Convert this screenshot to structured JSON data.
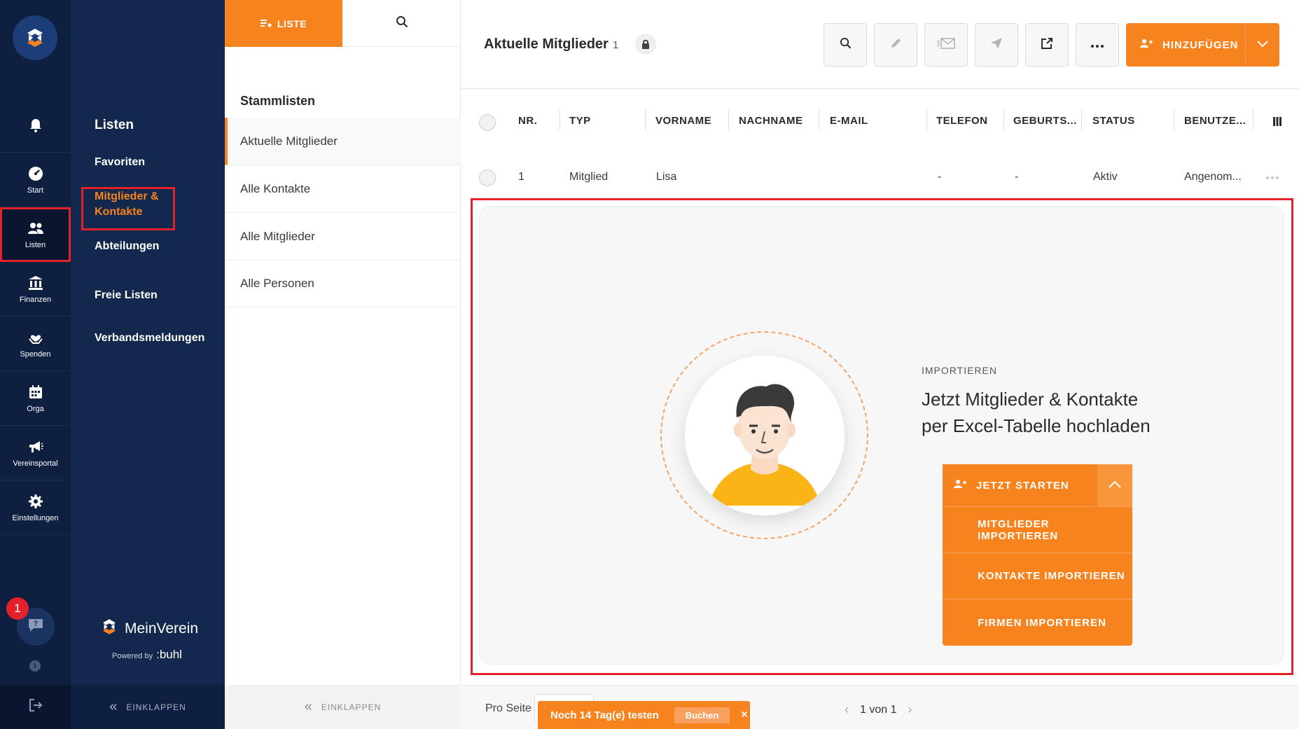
{
  "rail": {
    "items": [
      {
        "label": "",
        "icon": "bell-icon"
      },
      {
        "label": "Start",
        "icon": "dashboard-icon"
      },
      {
        "label": "Listen",
        "icon": "users-icon"
      },
      {
        "label": "Finanzen",
        "icon": "bank-icon"
      },
      {
        "label": "Spenden",
        "icon": "heart-hand-icon"
      },
      {
        "label": "Orga",
        "icon": "calendar-icon"
      },
      {
        "label": "Vereinsportal",
        "icon": "megaphone-icon"
      },
      {
        "label": "Einstellungen",
        "icon": "gear-icon"
      }
    ],
    "help_badge": "1"
  },
  "subnav": {
    "title": "Listen",
    "items": [
      "Favoriten",
      "Mitglieder & Kontakte",
      "Abteilungen",
      "Freie Listen",
      "Verbandsmeldungen"
    ],
    "active": "Mitglieder & Kontakte",
    "brand": "MeinVerein",
    "powered_by": "Powered by",
    "powered_brand": ":buhl",
    "collapse_label": "EINKLAPPEN"
  },
  "listpanel": {
    "tab_liste": "LISTE",
    "section_title": "Stammlisten",
    "lists": [
      "Aktuelle Mitglieder",
      "Alle Kontakte",
      "Alle Mitglieder",
      "Alle Personen"
    ],
    "active": "Aktuelle Mitglieder",
    "collapse_label": "EINKLAPPEN"
  },
  "main": {
    "title": "Aktuelle Mitglieder",
    "count": "1",
    "add_label": "HINZUFÜGEN",
    "columns": [
      "NR.",
      "TYP",
      "VORNAME",
      "NACHNAME",
      "E-MAIL",
      "TELEFON",
      "GEBURTS...",
      "STATUS",
      "BENUTZE..."
    ],
    "rows": [
      {
        "nr": "1",
        "typ": "Mitglied",
        "vorname": "Lisa",
        "nachname": "",
        "email": "",
        "telefon": "-",
        "geburts": "-",
        "status": "Aktiv",
        "benutzer": "Angenom..."
      }
    ],
    "import": {
      "kicker": "IMPORTIEREN",
      "title_line1": "Jetzt Mitglieder & Kontakte",
      "title_line2": "per Excel-Tabelle hochladen",
      "start_label": "JETZT STARTEN",
      "options": [
        "MITGLIEDER IMPORTIEREN",
        "KONTAKTE IMPORTIEREN",
        "FIRMEN IMPORTIEREN"
      ]
    },
    "footer": {
      "per_page_label": "Pro Seite",
      "trial_text": "Noch 14 Tag(e) testen",
      "trial_button": "Buchen",
      "trial_close": "×",
      "pagination": "1 von 1"
    }
  },
  "colors": {
    "accent": "#f7831f",
    "rail_bg": "#0e1f3f",
    "subnav_bg": "#13284d",
    "highlight": "#e3202b"
  }
}
